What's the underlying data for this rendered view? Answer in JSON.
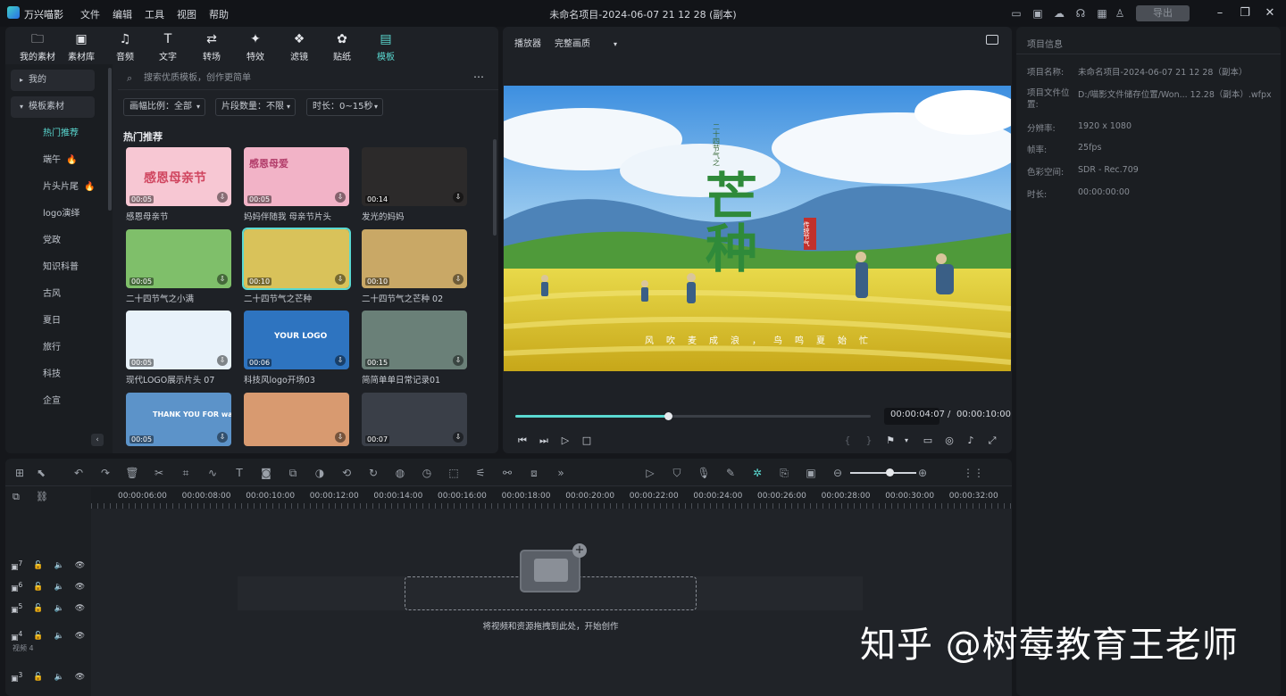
{
  "app": {
    "name": "万兴喵影",
    "window_title": "未命名项目-2024-06-07 21 12 28 (副本)",
    "export_label": "导出"
  },
  "menu": [
    "文件",
    "编辑",
    "工具",
    "视图",
    "帮助"
  ],
  "library_tabs": [
    {
      "label": "我的素材",
      "icon": "🗀"
    },
    {
      "label": "素材库",
      "icon": "▣"
    },
    {
      "label": "音频",
      "icon": "♫"
    },
    {
      "label": "文字",
      "icon": "T"
    },
    {
      "label": "转场",
      "icon": "⇄"
    },
    {
      "label": "特效",
      "icon": "✦"
    },
    {
      "label": "滤镜",
      "icon": "❖"
    },
    {
      "label": "贴纸",
      "icon": "✿"
    },
    {
      "label": "模板",
      "icon": "▤"
    }
  ],
  "sidebar": {
    "mine": "我的",
    "templates": "模板素材",
    "items": [
      "热门推荐",
      "端午",
      "片头片尾",
      "logo演绎",
      "党政",
      "知识科普",
      "古风",
      "夏日",
      "旅行",
      "科技",
      "企宣"
    ]
  },
  "search": {
    "placeholder": "搜索优质模板，创作更简单"
  },
  "filters": [
    "画幅比例：全部",
    "片段数量：不限",
    "时长：0~15秒"
  ],
  "section_title": "热门推荐",
  "templates": [
    {
      "name": "感恩母亲节",
      "duration": "00:05",
      "bg": "#f7c7d3"
    },
    {
      "name": "妈妈伴随我 母亲节片头",
      "duration": "00:05",
      "bg": "#f2b3c7"
    },
    {
      "name": "发光的妈妈",
      "duration": "00:14",
      "bg": "#2c2a2a"
    },
    {
      "name": "二十四节气之小满",
      "duration": "00:05",
      "bg": "#7fbf6a"
    },
    {
      "name": "二十四节气之芒种",
      "duration": "00:10",
      "bg": "#d9c25a"
    },
    {
      "name": "二十四节气之芒种 02",
      "duration": "00:10",
      "bg": "#c9a866"
    },
    {
      "name": "现代LOGO展示片头 07",
      "duration": "00:05",
      "bg": "#e8f2fa"
    },
    {
      "name": "科技风logo开场03",
      "duration": "00:06",
      "bg": "#2e74c0"
    },
    {
      "name": "简简单单日常记录01",
      "duration": "00:15",
      "bg": "#6a8078"
    },
    {
      "name": "",
      "duration": "00:05",
      "bg": "#5c93c9"
    },
    {
      "name": "",
      "duration": "",
      "bg": "#d89a70"
    },
    {
      "name": "",
      "duration": "00:07",
      "bg": "#3a3f48"
    }
  ],
  "thumb_texts": {
    "t1": "感恩母亲节",
    "t2": "感恩母爱",
    "t8": "YOUR LOGO",
    "t10": "THANK YOU FOR watching"
  },
  "player": {
    "label": "播放器",
    "quality": "完整画质",
    "current": "00:00:04:07",
    "total": "00:00:10:00",
    "progress": 0.43
  },
  "video_text": {
    "title": "芒种",
    "vertical_small": "二十四节气之",
    "seal": "传统节气",
    "subtitle": "风吹麦成浪，鸟鸣夏始忙"
  },
  "project_info": {
    "header": "项目信息",
    "rows": [
      {
        "k": "项目名称:",
        "v": "未命名项目-2024-06-07 21 12 28（副本）"
      },
      {
        "k": "项目文件位置:",
        "v": "D:/喵影文件储存位置/Won... 12.28（副本）.wfpx"
      },
      {
        "k": "分辨率:",
        "v": "1920 x 1080"
      },
      {
        "k": "帧率:",
        "v": "25fps"
      },
      {
        "k": "色彩空间:",
        "v": "SDR - Rec.709"
      },
      {
        "k": "时长:",
        "v": "00:00:00:00"
      }
    ]
  },
  "ruler": [
    "00:00:06:00",
    "00:00:08:00",
    "00:00:10:00",
    "00:00:12:00",
    "00:00:14:00",
    "00:00:16:00",
    "00:00:18:00",
    "00:00:20:00",
    "00:00:22:00",
    "00:00:24:00",
    "00:00:26:00",
    "00:00:28:00",
    "00:00:30:00",
    "00:00:32:00"
  ],
  "tracks": [
    {
      "num": "7",
      "label": ""
    },
    {
      "num": "6",
      "label": ""
    },
    {
      "num": "5",
      "label": ""
    },
    {
      "num": "4",
      "label": "视频 4"
    },
    {
      "num": "3",
      "label": ""
    }
  ],
  "drop_hint": "将视频和资源拖拽到此处，开始创作",
  "watermark": "知乎 @树莓教育王老师"
}
